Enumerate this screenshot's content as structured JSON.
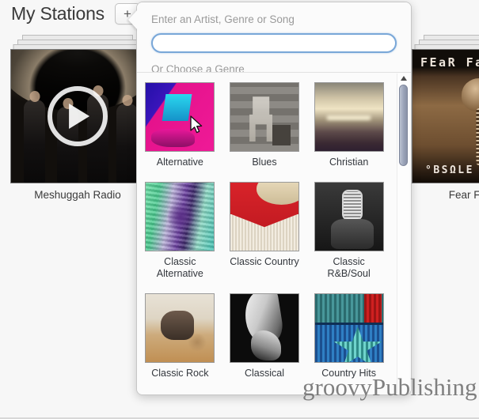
{
  "header": {
    "title": "My Stations",
    "add_button_label": "+"
  },
  "stations": [
    {
      "name": "Meshuggah Radio",
      "play_label": "play-overlay"
    },
    {
      "name": "Fear Factory",
      "art_band_text": "FEaR Fac",
      "art_album_text": "°BSΩLE"
    }
  ],
  "popover": {
    "search_prompt": "Enter an Artist, Genre or Song",
    "search_value": "",
    "search_placeholder": "",
    "genre_prompt": "Or Choose a Genre",
    "genres": [
      {
        "name": "Alternative"
      },
      {
        "name": "Blues"
      },
      {
        "name": "Christian"
      },
      {
        "name": "Classic Alternative"
      },
      {
        "name": "Classic Country"
      },
      {
        "name": "Classic R&B/Soul"
      },
      {
        "name": "Classic Rock"
      },
      {
        "name": "Classical"
      },
      {
        "name": "Country Hits"
      }
    ]
  },
  "watermark": {
    "text": "groovyPublishing"
  },
  "colors": {
    "accent_blue": "#79a7d8",
    "panel_bg": "#fbfbfb",
    "page_bg": "#f7f7f7",
    "text_dark": "#33373d",
    "text_muted": "#9a9a9a"
  }
}
